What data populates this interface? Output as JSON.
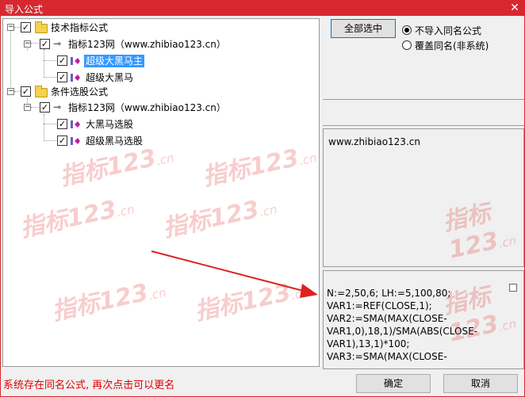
{
  "window": {
    "title": "导入公式",
    "close_glyph": "✕"
  },
  "tree": {
    "nodes": [
      {
        "expander": "−",
        "checked": true,
        "icon": "folder-icon",
        "label": "技术指标公式"
      },
      {
        "expander": "−",
        "checked": true,
        "icon": "key-icon",
        "label": "指标123网（www.zhibiao123.cn）"
      },
      {
        "checked": true,
        "icon": "formula-icon",
        "label": "超级大黑马主",
        "selected": true
      },
      {
        "checked": true,
        "icon": "formula-icon",
        "label": "超级大黑马"
      },
      {
        "expander": "−",
        "checked": true,
        "icon": "folder-icon",
        "label": "条件选股公式"
      },
      {
        "expander": "−",
        "checked": true,
        "icon": "key-icon",
        "label": "指标123网（www.zhibiao123.cn）"
      },
      {
        "checked": true,
        "icon": "formula-icon",
        "label": "大黑马选股"
      },
      {
        "checked": true,
        "icon": "formula-icon",
        "label": "超级黑马选股"
      }
    ],
    "check_glyph": "✓"
  },
  "watermark": {
    "text": "指标123",
    "suffix": ".cn"
  },
  "right": {
    "select_all_label": "全部选中",
    "options": [
      {
        "label": "不导入同名公式",
        "selected": true
      },
      {
        "label": "覆盖同名(非系统)",
        "selected": false
      }
    ],
    "info_text": "www.zhibiao123.cn",
    "code_lines": [
      "N:=2,50,6; LH:=5,100,80;",
      "VAR1:=REF(CLOSE,1);",
      "VAR2:=SMA(MAX(CLOSE-",
      "VAR1,0),18,1)/SMA(ABS(CLOSE-",
      "VAR1),13,1)*100;",
      "VAR3:=SMA(MAX(CLOSE-"
    ]
  },
  "footer": {
    "status_text": "系统存在同名公式, 再次点击可以更名",
    "ok_label": "确定",
    "cancel_label": "取消"
  },
  "colors": {
    "titlebar": "#d7282f",
    "status": "#e00000",
    "arrow": "#e02020",
    "selection": "#3399ff"
  }
}
